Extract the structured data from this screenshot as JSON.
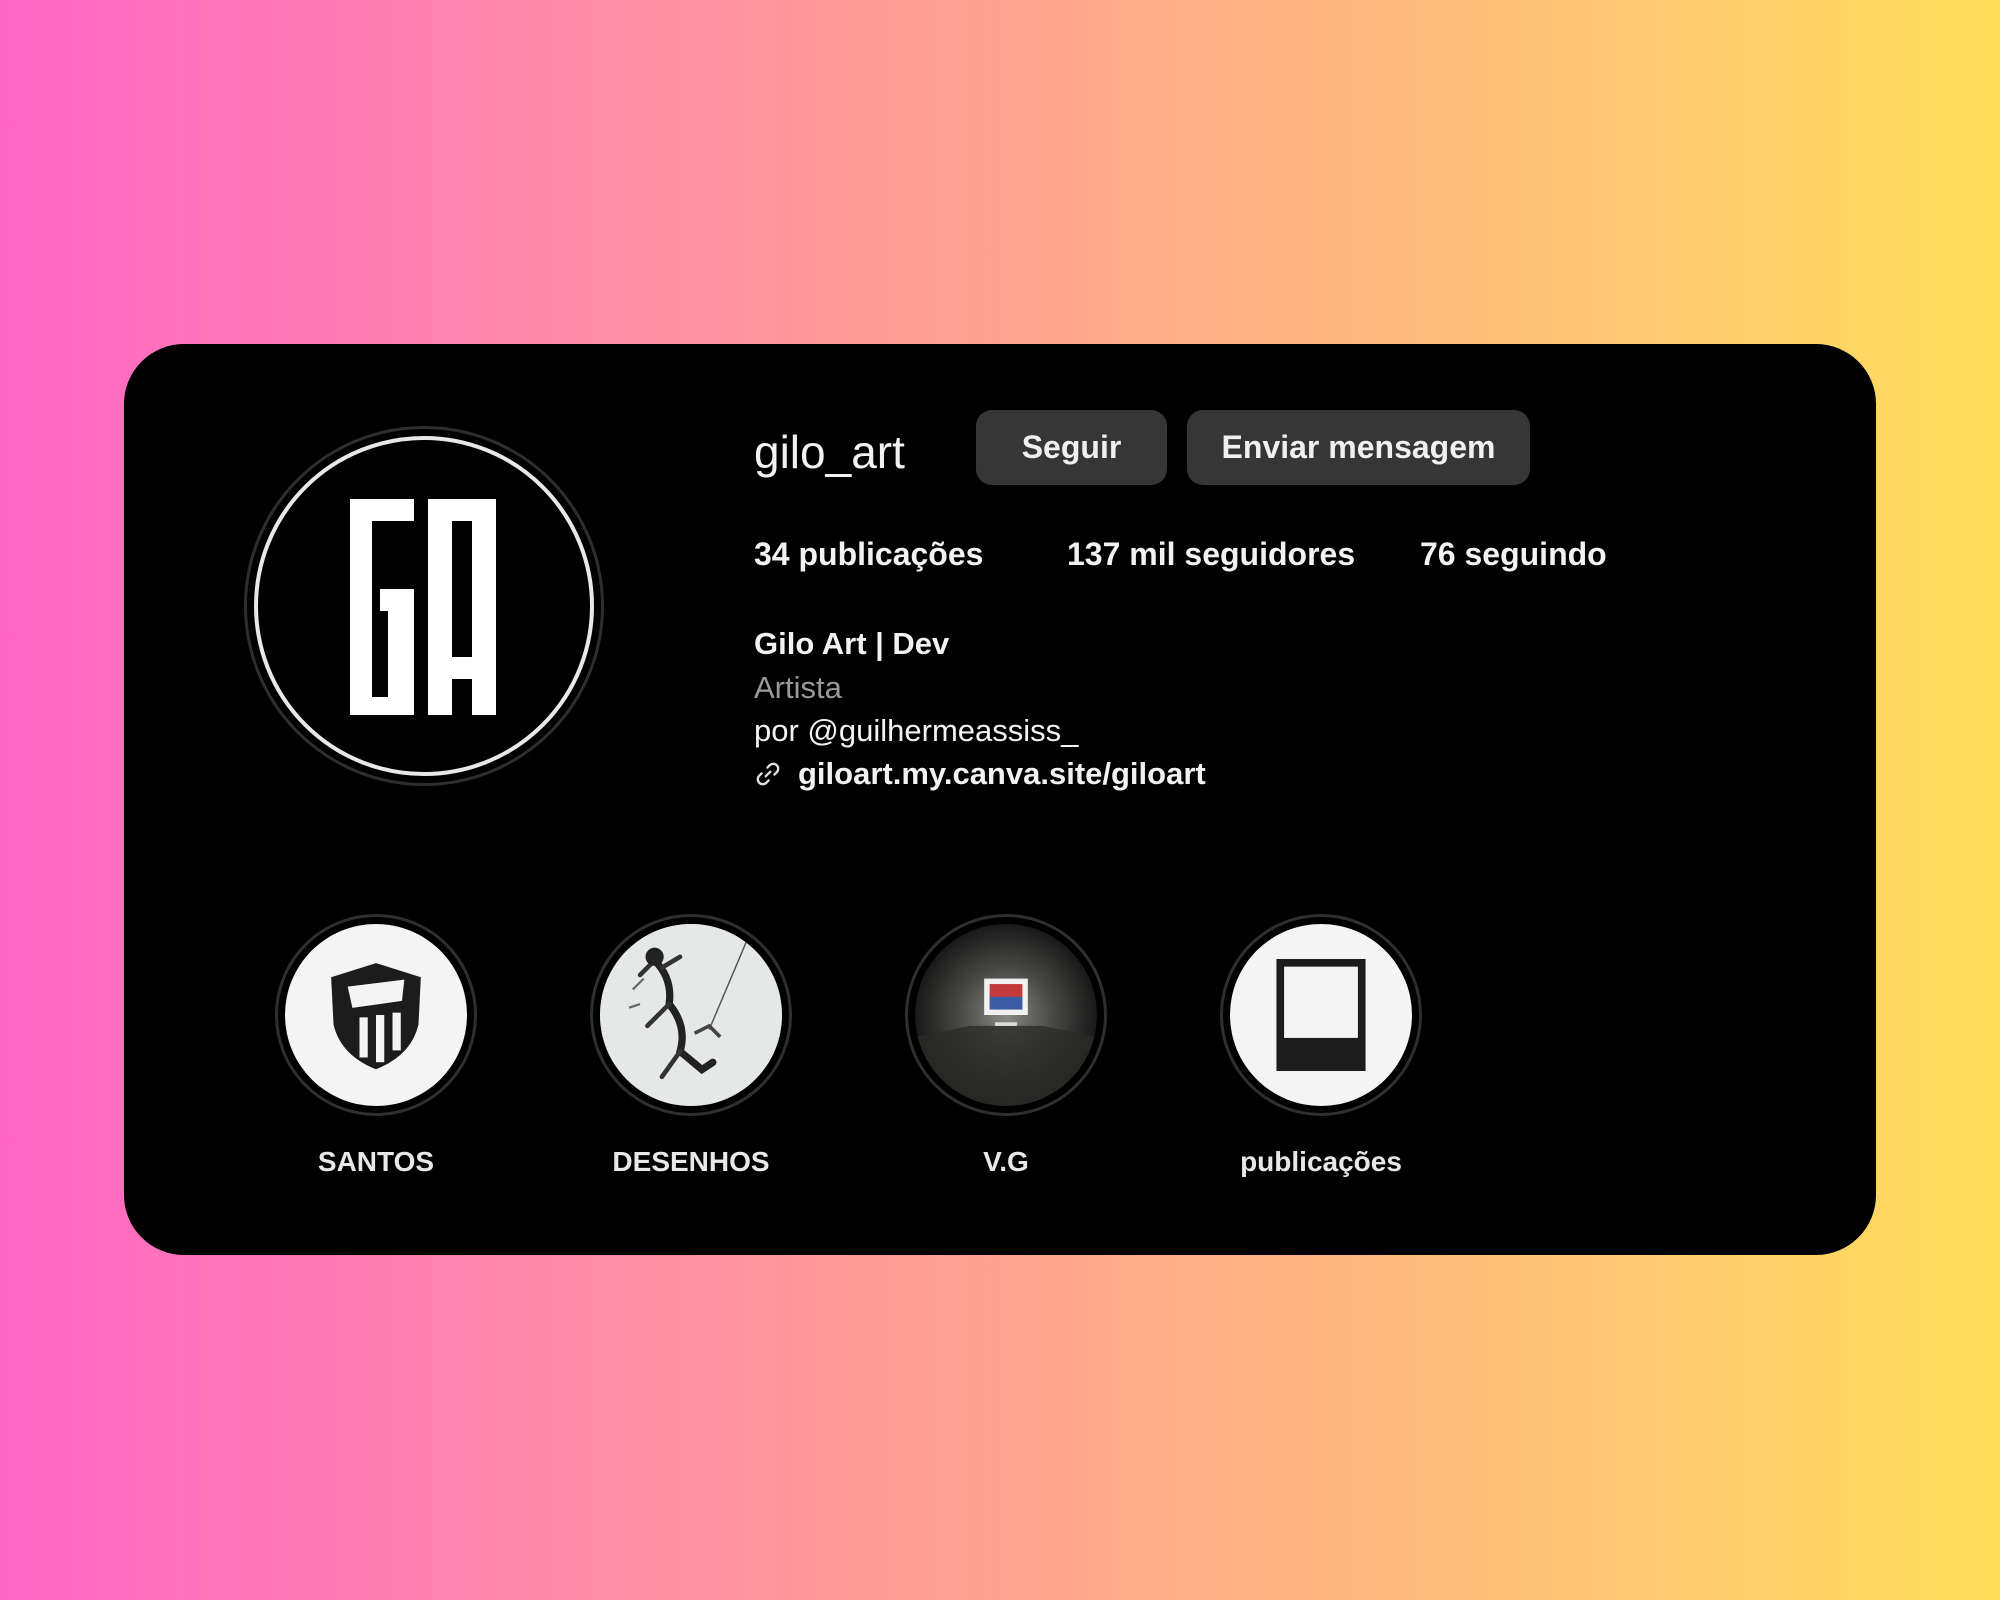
{
  "profile": {
    "username": "gilo_art",
    "avatar_icon": "ga-monogram-logo",
    "follow_label": "Seguir",
    "message_label": "Enviar mensagem"
  },
  "stats": {
    "posts": "34 publicações",
    "followers": "137 mil seguidores",
    "following": "76 seguindo"
  },
  "bio": {
    "name": "Gilo Art | Dev",
    "category": "Artista",
    "text": "por @guilhermeassiss_",
    "link_icon": "link-icon",
    "link": "giloart.my.canva.site/giloart"
  },
  "highlights": [
    {
      "label": "SANTOS",
      "icon": "santos-shield-icon"
    },
    {
      "label": "DESENHOS",
      "icon": "sketch-drawing-thumbnail"
    },
    {
      "label": "V.G",
      "icon": "gallery-frame-thumbnail"
    },
    {
      "label": "publicações",
      "icon": "polaroid-frame-icon"
    }
  ],
  "colors": {
    "card": "#000000",
    "button": "#363636",
    "text": "#f2f2f2",
    "muted": "#9a9a9a",
    "gradient_left": "#ff66c4",
    "gradient_right": "#ffde59"
  }
}
